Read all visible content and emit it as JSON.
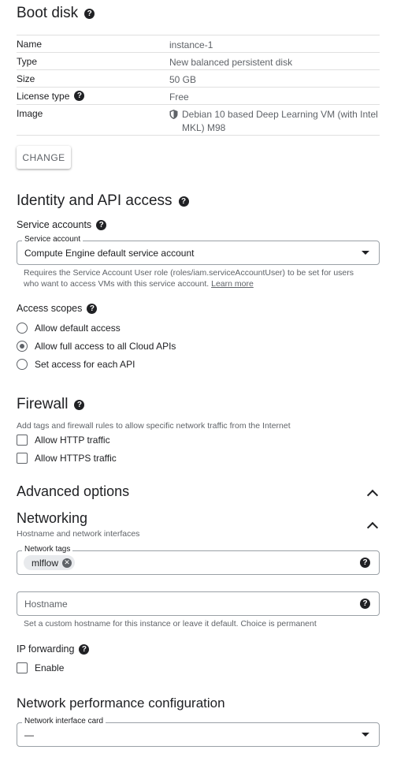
{
  "boot_disk": {
    "title": "Boot disk",
    "rows": [
      {
        "key": "Name",
        "value": "instance-1"
      },
      {
        "key": "Type",
        "value": "New balanced persistent disk"
      },
      {
        "key": "Size",
        "value": "50 GB"
      },
      {
        "key": "License type",
        "value": "Free"
      },
      {
        "key": "Image",
        "value": "Debian 10 based Deep Learning VM (with Intel MKL) M98"
      }
    ],
    "change_label": "CHANGE"
  },
  "identity": {
    "title": "Identity and API access",
    "service_accounts_label": "Service accounts",
    "service_account_legend": "Service account",
    "service_account_value": "Compute Engine default service account",
    "hint": "Requires the Service Account User role (roles/iam.serviceAccountUser) to be set for users who want to access VMs with this service account.",
    "learn_more": "Learn more",
    "access_scopes_label": "Access scopes",
    "scopes": [
      {
        "label": "Allow default access",
        "selected": false
      },
      {
        "label": "Allow full access to all Cloud APIs",
        "selected": true
      },
      {
        "label": "Set access for each API",
        "selected": false
      }
    ]
  },
  "firewall": {
    "title": "Firewall",
    "description": "Add tags and firewall rules to allow specific network traffic from the Internet",
    "options": [
      {
        "label": "Allow HTTP traffic",
        "checked": false
      },
      {
        "label": "Allow HTTPS traffic",
        "checked": false
      }
    ]
  },
  "advanced": {
    "title": "Advanced options"
  },
  "networking": {
    "title": "Networking",
    "subtitle": "Hostname and network interfaces",
    "network_tags_legend": "Network tags",
    "tag": "mlflow",
    "hostname_placeholder": "Hostname",
    "hostname_hint": "Set a custom hostname for this instance or leave it default. Choice is permanent",
    "ip_forwarding_label": "IP forwarding",
    "enable_label": "Enable"
  },
  "performance": {
    "title": "Network performance configuration",
    "nic_legend": "Network interface card",
    "nic_value": "—"
  }
}
